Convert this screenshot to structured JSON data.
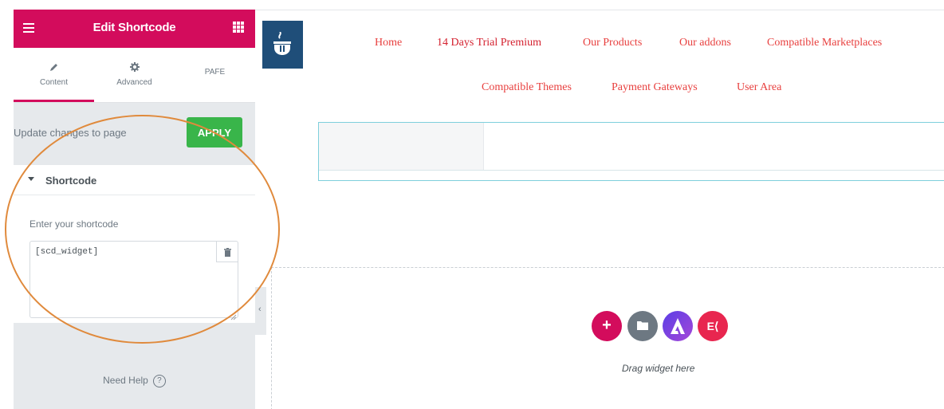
{
  "panel": {
    "title": "Edit Shortcode",
    "tabs": [
      {
        "label": "Content",
        "icon": "pencil-icon"
      },
      {
        "label": "Advanced",
        "icon": "gear-icon"
      },
      {
        "label": "PAFE"
      }
    ],
    "apply_row": {
      "text": "Update changes to page",
      "button": "APPLY"
    },
    "section": {
      "title": "Shortcode",
      "field_label": "Enter your shortcode",
      "field_value": "[scd_widget]"
    },
    "help": {
      "label": "Need Help",
      "icon_text": "?"
    }
  },
  "site": {
    "nav": [
      {
        "label": "Home"
      },
      {
        "label": "14 Days Trial Premium"
      },
      {
        "label": "Our Products"
      },
      {
        "label": "Our addons"
      },
      {
        "label": "Compatible Marketplaces"
      },
      {
        "label": "Compatible Themes"
      },
      {
        "label": "Payment Gateways"
      },
      {
        "label": "User Area"
      }
    ],
    "drop_zone": {
      "hint": "Drag widget here",
      "ek_label": "E⟨"
    }
  },
  "colors": {
    "brand": "#d30c5c",
    "apply": "#39b54a",
    "nav": "#e8403f",
    "highlight": "#e08a3c"
  }
}
